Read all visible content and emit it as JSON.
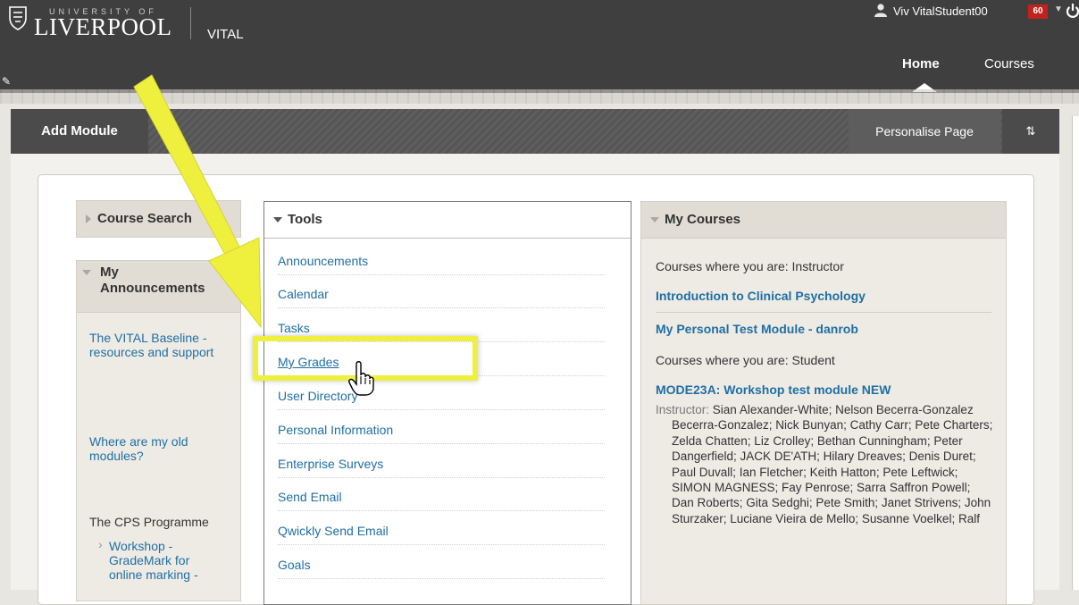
{
  "header": {
    "university_small": "UNIVERSITY OF",
    "university_big": "LIVERPOOL",
    "app_name": "VITAL",
    "user_name": "Viv VitalStudent00",
    "notification_count": "60",
    "nav": {
      "home": "Home",
      "courses": "Courses"
    }
  },
  "toolbar": {
    "add_module": "Add Module",
    "personalise": "Personalise Page",
    "reorder_icon": "⇅"
  },
  "modules": {
    "course_search": {
      "title": "Course Search"
    },
    "announcements": {
      "title_line1": "My",
      "title_line2": "Announcements",
      "items": [
        "The VITAL Baseline - resources and support",
        "Where are my old modules?",
        "The CPS Programme"
      ],
      "sub_item": "Workshop - GradeMark for online marking -"
    },
    "tools": {
      "title": "Tools",
      "items": [
        "Announcements",
        "Calendar",
        "Tasks",
        "My Grades",
        "User Directory",
        "Personal Information",
        "Enterprise Surveys",
        "Send Email",
        "Qwickly Send Email",
        "Goals"
      ]
    },
    "courses": {
      "title": "My Courses",
      "instructor_label": "Courses where you are: Instructor",
      "instructor_courses": [
        "Introduction to Clinical Psychology",
        "My Personal Test Module - danrob"
      ],
      "student_label": "Courses where you are: Student",
      "student_course": "MODE23A: Workshop test module NEW",
      "instructor_prefix": "Instructor:",
      "instructors": "Sian Alexander-White;  Nelson Becerra-Gonzalez Becerra-Gonzalez;  Nick Bunyan;  Cathy Carr;  Pete Charters;  Zelda Chatten;  Liz Crolley;  Bethan Cunningham;  Peter Dangerfield;  JACK DE'ATH;  Hilary Dreaves;  Denis Duret;  Paul Duvall;  Ian Fletcher;  Keith Hatton;  Pete Leftwick;  SIMON MAGNESS;  Fay Penrose;  Sarra Saffron Powell;  Dan Roberts;  Gita Sedghi;  Pete Smith;  Janet Strivens;  John Sturzaker;  Luciane Vieira de Mello;  Susanne Voelkel;  Ralf"
    }
  },
  "annotation": {
    "highlight_color": "#eef03d"
  },
  "colors": {
    "header_bg": "#3f3f3f",
    "link": "#1f6fa3",
    "badge": "#c0231d"
  },
  "icons": [
    "crest-logo-icon",
    "user-icon",
    "power-icon",
    "pencil-icon",
    "reorder-icon",
    "hand-cursor-icon",
    "annotation-arrow"
  ]
}
